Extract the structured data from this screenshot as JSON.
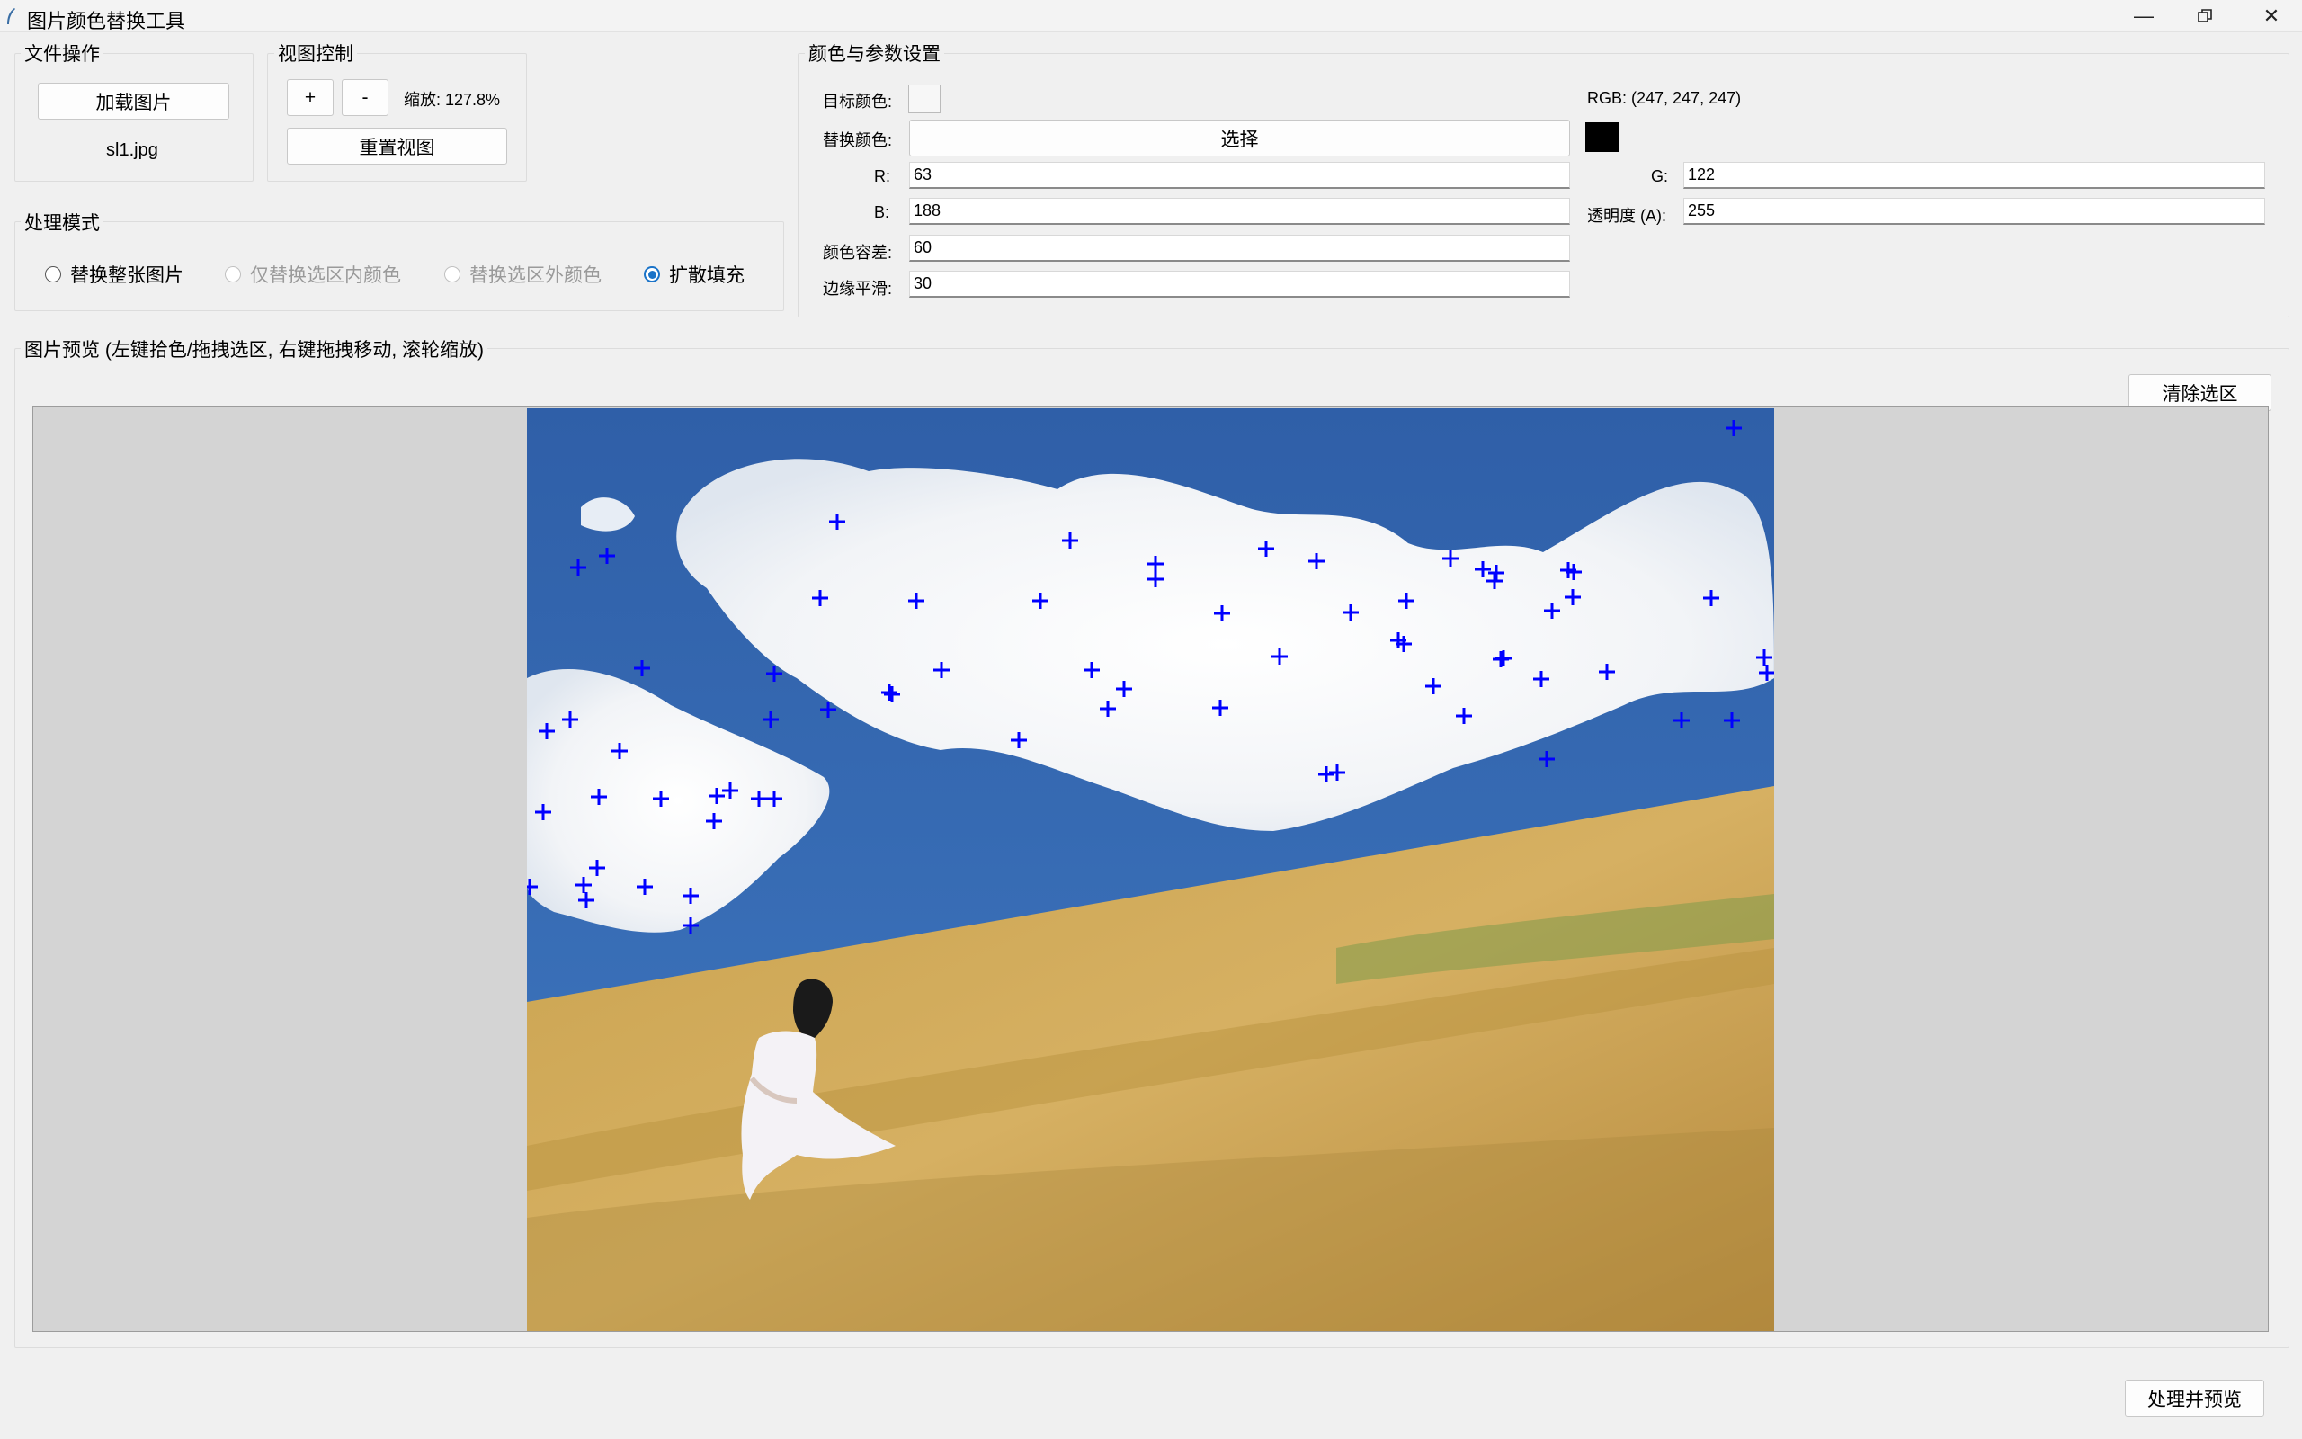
{
  "window": {
    "title": "图片颜色替换工具"
  },
  "file_ops": {
    "title": "文件操作",
    "load_button": "加载图片",
    "filename": "sl1.jpg"
  },
  "view_ctrl": {
    "title": "视图控制",
    "zoom_in": "+",
    "zoom_out": "-",
    "zoom_text": "缩放: 127.8%",
    "reset_button": "重置视图"
  },
  "mode": {
    "title": "处理模式",
    "options": [
      {
        "label": "替换整张图片",
        "checked": false,
        "disabled": false
      },
      {
        "label": "仅替换选区内颜色",
        "checked": false,
        "disabled": true
      },
      {
        "label": "替换选区外颜色",
        "checked": false,
        "disabled": true
      },
      {
        "label": "扩散填充",
        "checked": true,
        "disabled": false
      }
    ]
  },
  "params": {
    "title": "颜色与参数设置",
    "target_label": "目标颜色:",
    "target_color": "#f7f7f7",
    "target_rgb": "RGB: (247, 247, 247)",
    "replace_label": "替换颜色:",
    "choose_button": "选择",
    "replace_color": "#000000",
    "r_label": "R:",
    "r_value": "63",
    "g_label": "G:",
    "g_value": "122",
    "b_label": "B:",
    "b_value": "188",
    "a_label": "透明度 (A):",
    "a_value": "255",
    "tol_label": "颜色容差:",
    "tol_value": "60",
    "smooth_label": "边缘平滑:",
    "smooth_value": "30"
  },
  "preview": {
    "title": "图片预览 (左键拾色/拖拽选区, 右键拖拽移动, 滚轮缩放)",
    "clear_button": "清除选区",
    "markers_color": "#0000ff"
  },
  "footer": {
    "process_button": "处理并预览"
  }
}
